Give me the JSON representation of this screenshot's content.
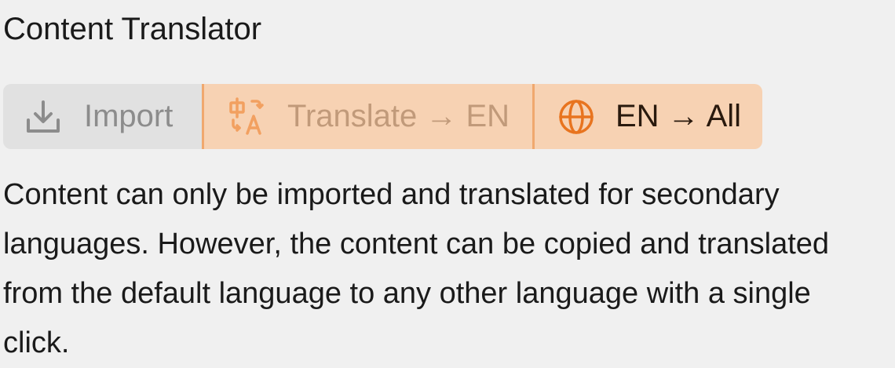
{
  "section": {
    "title": "Content Translator"
  },
  "toolbar": {
    "import_label": "Import",
    "translate_label": "Translate → EN",
    "translate_all_label": "EN → All",
    "icons": {
      "import": "download-tray-icon",
      "translate": "translate-icon",
      "translate_all": "globe-icon"
    },
    "colors": {
      "accent": "#e8741f",
      "accent_bg": "#f7d2b3",
      "disabled_bg": "#e1e1e1"
    }
  },
  "description": "Content can only be imported and translated for secondary languages. However, the content can be copied and translated from the default language to any other language with a single click."
}
